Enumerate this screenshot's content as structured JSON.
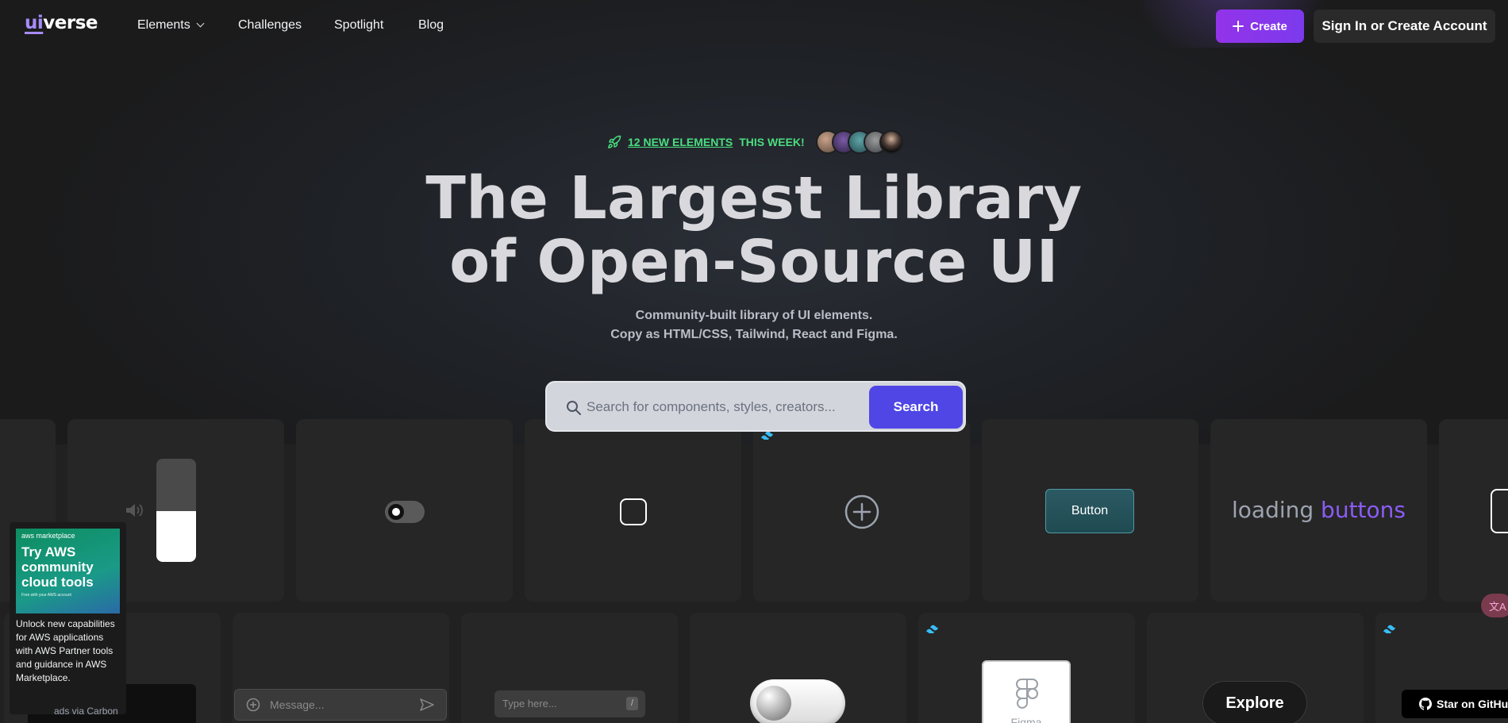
{
  "brand": {
    "logo_prefix": "ui",
    "logo_suffix": "verse"
  },
  "nav": {
    "elements": "Elements",
    "challenges": "Challenges",
    "spotlight": "Spotlight",
    "blog": "Blog",
    "create": "Create",
    "sign_in": "Sign In or Create Account"
  },
  "hero": {
    "badge_link": "12 NEW ELEMENTS",
    "badge_rest": "THIS WEEK!",
    "title_line1": "The Largest Library",
    "title_line2": "of Open-Source UI",
    "subtitle_line1": "Community-built library of UI elements.",
    "subtitle_line2": "Copy as HTML/CSS, Tailwind, React and Figma."
  },
  "search": {
    "placeholder": "Search for components, styles, creators...",
    "button": "Search"
  },
  "cards": {
    "button_label": "Button",
    "loading_word": "loading",
    "buttons_word": "buttons",
    "message_placeholder": "Message...",
    "type_placeholder": "Type here...",
    "figma_label": "Figma",
    "explore_label": "Explore",
    "github_label": "Star on GitHub"
  },
  "ad": {
    "marketplace": "aws marketplace",
    "headline": "Try AWS community cloud tools",
    "fine_print": "Free with your AWS account",
    "body": "Unlock new capabilities for AWS applications with AWS Partner tools and guidance in AWS Marketplace.",
    "via": "ads via Carbon"
  },
  "colors": {
    "accent_purple": "#9333ea",
    "search_button": "#4f46e5",
    "badge_green": "#4ade80",
    "page_background": "#212121"
  }
}
